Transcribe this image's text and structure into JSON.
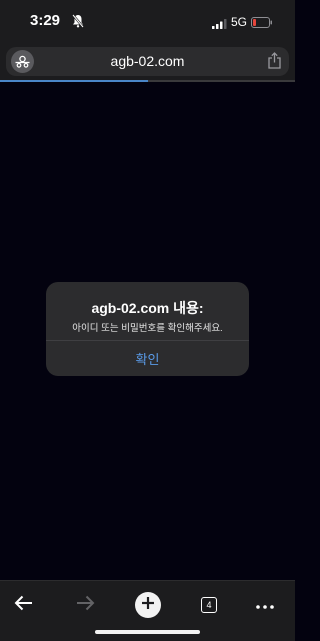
{
  "status_bar": {
    "time": "3:29",
    "network": "5G"
  },
  "address_bar": {
    "url": "agb-02.com"
  },
  "page_load_progress": 0.5,
  "dialog": {
    "title": "agb-02.com 내용:",
    "message": "아이디 또는 비밀번호를 확인해주세요.",
    "confirm_label": "확인"
  },
  "toolbar": {
    "tab_count": "4"
  },
  "colors": {
    "page_background": "#03020f",
    "chrome_background": "#1c1c1e",
    "dialog_background": "#2c2c2e",
    "accent": "#5a9be8",
    "progress": "#4a86c8",
    "battery_low": "#e5453b"
  },
  "icons": [
    "bell-slash-icon",
    "signal-icon",
    "battery-icon",
    "site-settings-icon",
    "share-icon",
    "back-arrow-icon",
    "forward-arrow-icon",
    "plus-icon",
    "tabs-icon",
    "more-icon"
  ]
}
